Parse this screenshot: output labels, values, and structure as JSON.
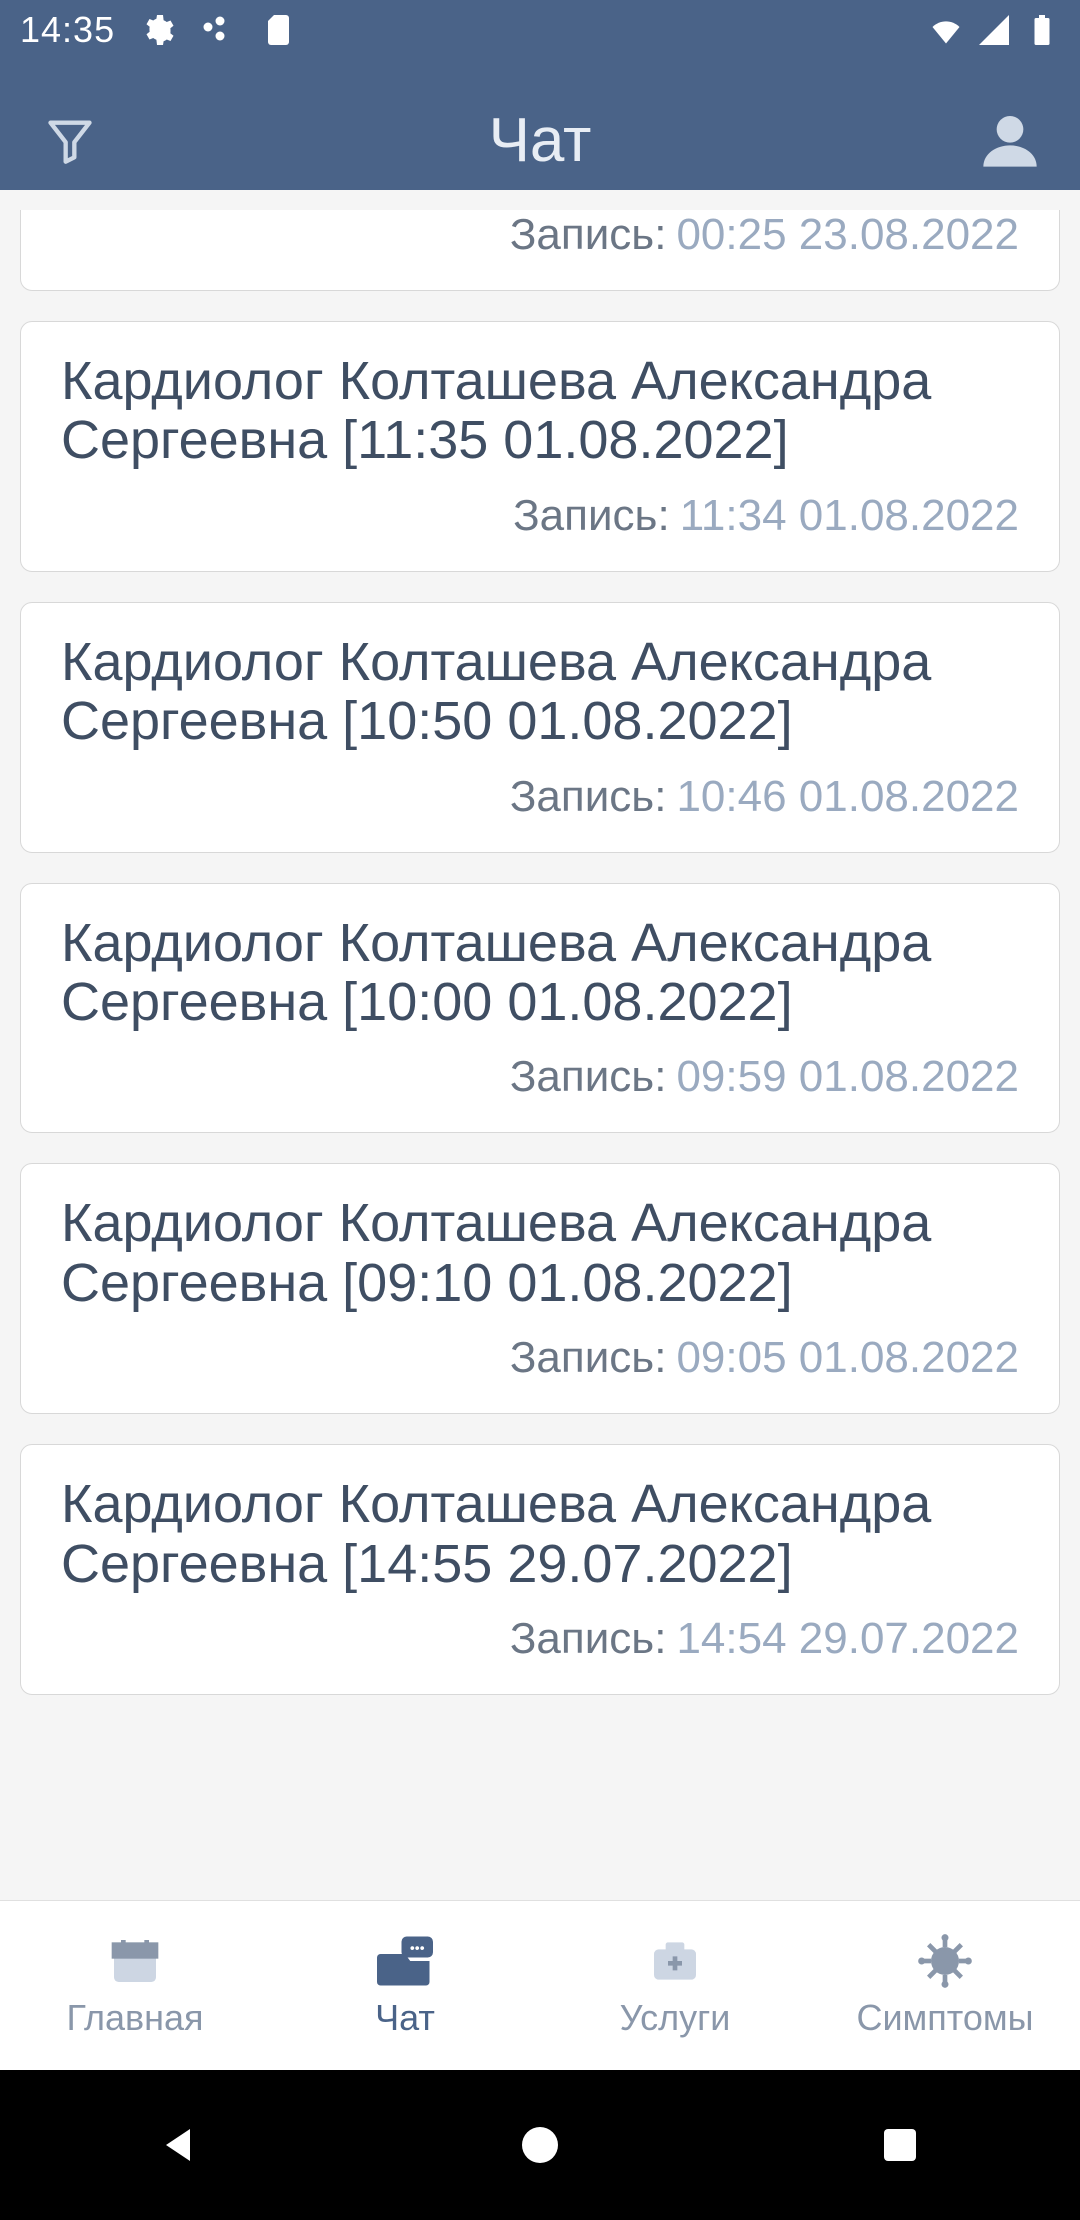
{
  "status": {
    "time": "14:35"
  },
  "header": {
    "title": "Чат"
  },
  "list": {
    "record_label": "Запись:",
    "items": [
      {
        "title": "",
        "timestamp": "00:25 23.08.2022",
        "partial": true
      },
      {
        "title": "Кардиолог Колташева Александра Сергеевна [11:35 01.08.2022]",
        "timestamp": "11:34 01.08.2022"
      },
      {
        "title": "Кардиолог Колташева Александра Сергеевна [10:50 01.08.2022]",
        "timestamp": "10:46 01.08.2022"
      },
      {
        "title": "Кардиолог Колташева Александра Сергеевна [10:00 01.08.2022]",
        "timestamp": "09:59 01.08.2022"
      },
      {
        "title": "Кардиолог Колташева Александра Сергеевна [09:10 01.08.2022]",
        "timestamp": "09:05 01.08.2022"
      },
      {
        "title": "Кардиолог Колташева Александра Сергеевна [14:55 29.07.2022]",
        "timestamp": "14:54 29.07.2022"
      }
    ]
  },
  "nav": {
    "items": [
      {
        "label": "Главная"
      },
      {
        "label": "Чат"
      },
      {
        "label": "Услуги"
      },
      {
        "label": "Симптомы"
      }
    ],
    "active": 1
  }
}
